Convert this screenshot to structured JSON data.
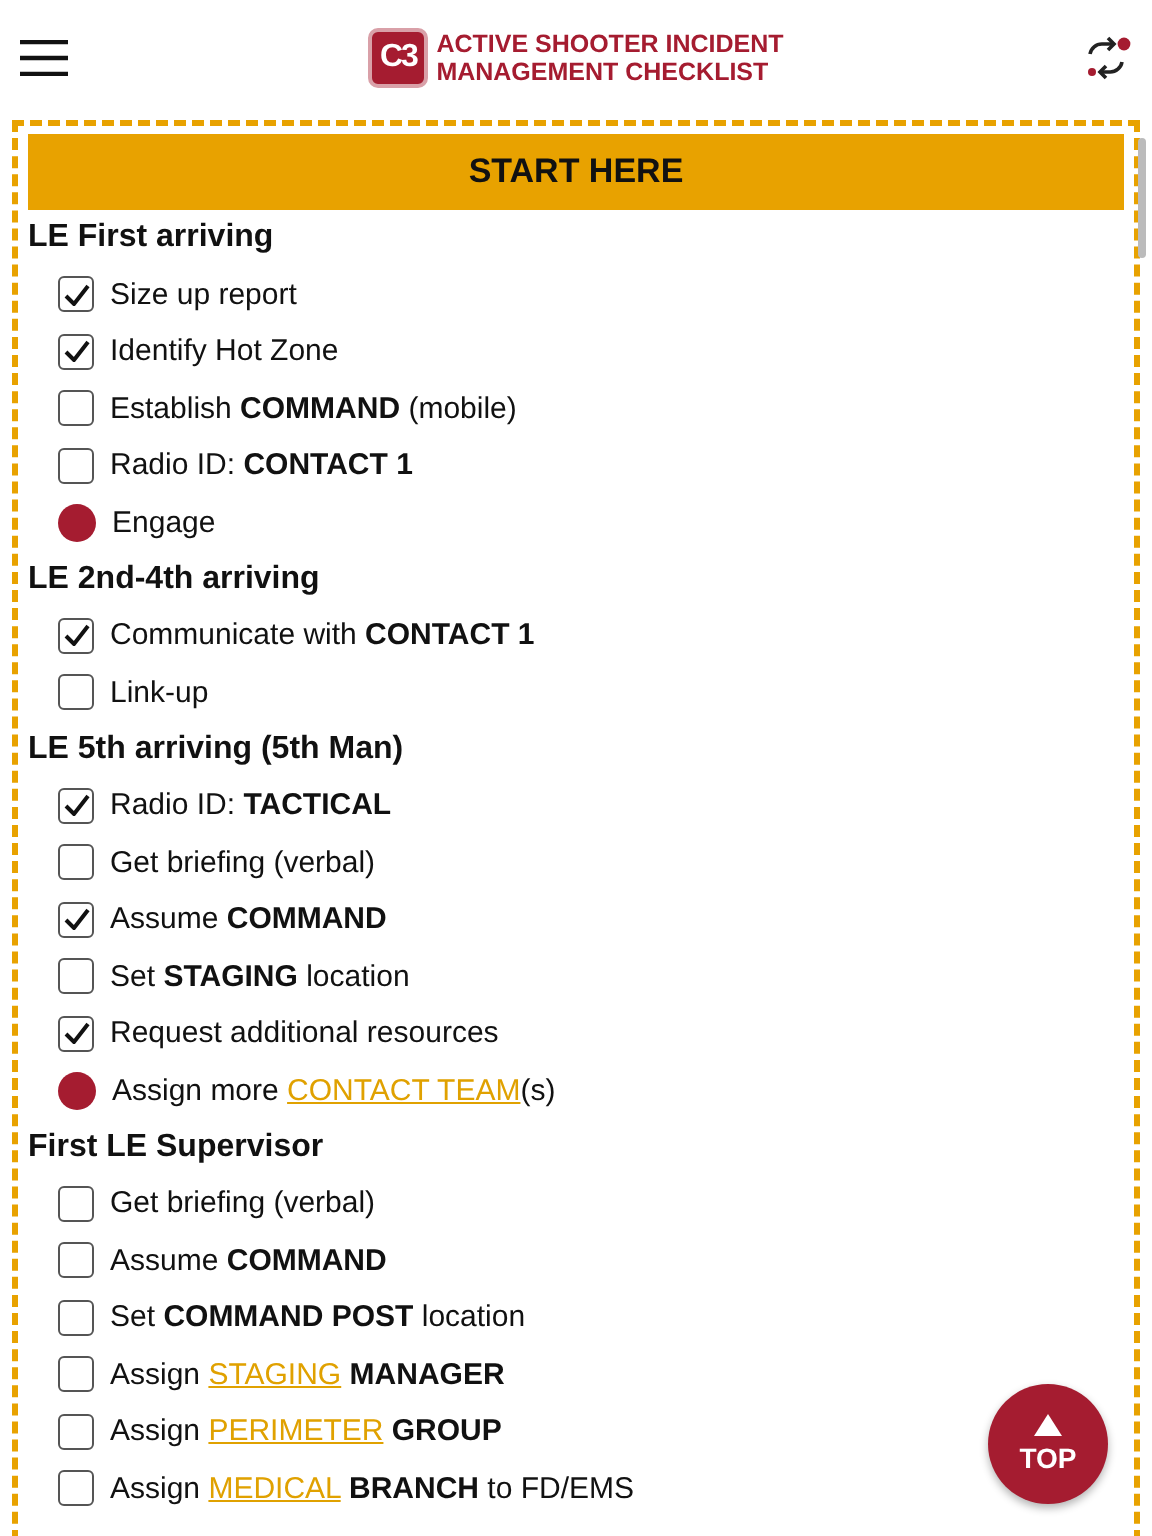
{
  "header": {
    "logo_mark": "C3",
    "title_lines": [
      "ACTIVE SHOOTER INCIDENT",
      "MANAGEMENT CHECKLIST"
    ]
  },
  "start_banner": "START HERE",
  "sections": [
    {
      "title": "LE First arriving",
      "items": [
        {
          "kind": "check",
          "checked": true,
          "parts": [
            {
              "kind": "text",
              "text": "Size up report"
            }
          ]
        },
        {
          "kind": "check",
          "checked": true,
          "parts": [
            {
              "kind": "text",
              "text": "Identify Hot Zone"
            }
          ]
        },
        {
          "kind": "check",
          "checked": false,
          "parts": [
            {
              "kind": "text",
              "text": "Establish **COMMAND** (mobile)"
            }
          ]
        },
        {
          "kind": "check",
          "checked": false,
          "parts": [
            {
              "kind": "text",
              "text": "Radio ID: **CONTACT 1**"
            }
          ]
        },
        {
          "kind": "action",
          "parts": [
            {
              "kind": "text",
              "text": "Engage"
            }
          ]
        }
      ]
    },
    {
      "title": "LE 2nd-4th arriving",
      "items": [
        {
          "kind": "check",
          "checked": true,
          "parts": [
            {
              "kind": "text",
              "text": "Communicate with **CONTACT 1**"
            }
          ]
        },
        {
          "kind": "check",
          "checked": false,
          "parts": [
            {
              "kind": "text",
              "text": "Link-up"
            }
          ]
        }
      ]
    },
    {
      "title": "LE 5th arriving (5th Man)",
      "items": [
        {
          "kind": "check",
          "checked": true,
          "parts": [
            {
              "kind": "text",
              "text": "Radio ID: **TACTICAL**"
            }
          ]
        },
        {
          "kind": "check",
          "checked": false,
          "parts": [
            {
              "kind": "text",
              "text": "Get briefing (verbal)"
            }
          ]
        },
        {
          "kind": "check",
          "checked": true,
          "parts": [
            {
              "kind": "text",
              "text": "Assume **COMMAND**"
            }
          ]
        },
        {
          "kind": "check",
          "checked": false,
          "parts": [
            {
              "kind": "text",
              "text": "Set **STAGING** location"
            }
          ]
        },
        {
          "kind": "check",
          "checked": true,
          "parts": [
            {
              "kind": "text",
              "text": "Request additional resources"
            }
          ]
        },
        {
          "kind": "action",
          "parts": [
            {
              "kind": "text",
              "text": "Assign more "
            },
            {
              "kind": "link",
              "text": "CONTACT TEAM"
            },
            {
              "kind": "text",
              "text": "(s)"
            }
          ]
        }
      ]
    },
    {
      "title": "First LE Supervisor",
      "items": [
        {
          "kind": "check",
          "checked": false,
          "parts": [
            {
              "kind": "text",
              "text": "Get briefing (verbal)"
            }
          ]
        },
        {
          "kind": "check",
          "checked": false,
          "parts": [
            {
              "kind": "text",
              "text": "Assume **COMMAND**"
            }
          ]
        },
        {
          "kind": "check",
          "checked": false,
          "parts": [
            {
              "kind": "text",
              "text": "Set **COMMAND POST** location"
            }
          ]
        },
        {
          "kind": "check",
          "checked": false,
          "parts": [
            {
              "kind": "text",
              "text": "Assign "
            },
            {
              "kind": "link",
              "text": "STAGING"
            },
            {
              "kind": "text",
              "text": " **MANAGER**"
            }
          ]
        },
        {
          "kind": "check",
          "checked": false,
          "parts": [
            {
              "kind": "text",
              "text": "Assign "
            },
            {
              "kind": "link",
              "text": "PERIMETER"
            },
            {
              "kind": "text",
              "text": " **GROUP**"
            }
          ]
        },
        {
          "kind": "check",
          "checked": false,
          "parts": [
            {
              "kind": "text",
              "text": "Assign "
            },
            {
              "kind": "link",
              "text": "MEDICAL"
            },
            {
              "kind": "text",
              "text": " **BRANCH** to FD/EMS"
            }
          ]
        }
      ]
    }
  ],
  "top_button": "TOP"
}
